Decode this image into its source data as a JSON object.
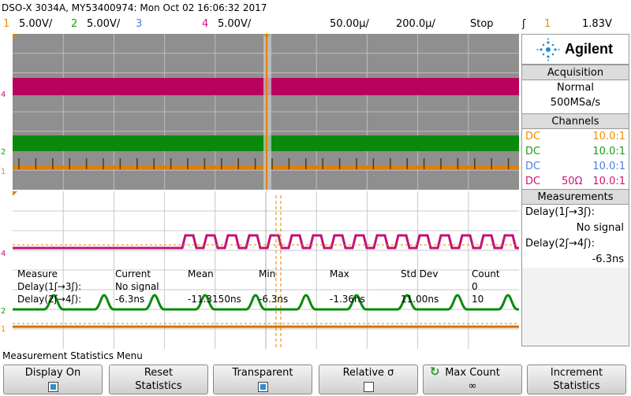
{
  "title": "DSO-X 3034A, MY53400974: Mon Oct 02 16:06:32 2017",
  "channel_bar": {
    "ch1_num": "1",
    "ch1_scale": "5.00V/",
    "ch2_num": "2",
    "ch2_scale": "5.00V/",
    "ch3_num": "3",
    "ch4_num": "4",
    "ch4_scale": "5.00V/",
    "time_delay": "50.00µ/",
    "time_scale": "200.0µ/",
    "run_state": "Stop",
    "trigger_icon": "ʃ",
    "trigger_source": "1",
    "trigger_level": "1.83V"
  },
  "side_panel": {
    "brand": "Agilent",
    "acquisition_title": "Acquisition",
    "acq_mode": "Normal",
    "acq_rate": "500MSa/s",
    "channels_title": "Channels",
    "channels": [
      {
        "coupling": "DC",
        "impedance": "",
        "ratio": "10.0:1",
        "color": "#f28c00"
      },
      {
        "coupling": "DC",
        "impedance": "",
        "ratio": "10.0:1",
        "color": "#17a017"
      },
      {
        "coupling": "DC",
        "impedance": "",
        "ratio": "10.0:1",
        "color": "#4f7ee0"
      },
      {
        "coupling": "DC",
        "impedance": "50Ω",
        "ratio": "10.0:1",
        "color": "#d0127a"
      }
    ],
    "measurements_title": "Measurements",
    "meas1_label": "Delay(1ʃ→3ʃ):",
    "meas1_value": "No signal",
    "meas2_label": "Delay(2ʃ→4ʃ):",
    "meas2_value": "-6.3ns"
  },
  "stats_table": {
    "h_measure": "Measure",
    "h_current": "Current",
    "h_mean": "Mean",
    "h_min": "Min",
    "h_max": "Max",
    "h_std": "Std Dev",
    "h_count": "Count",
    "r1_name": "Delay(1ʃ→3ʃ):",
    "r1_current": "No signal",
    "r1_count": "0",
    "r2_name": "Delay(2ʃ→4ʃ):",
    "r2_current": "-6.3ns",
    "r2_mean": "-11.3150ns",
    "r2_min": "-6.3ns",
    "r2_max": "-1.36ns",
    "r2_std": "11.00ns",
    "r2_count": "10"
  },
  "menu_title": "Measurement Statistics Menu",
  "softkeys": [
    {
      "line1": "Display On",
      "line2": "",
      "checkbox": true,
      "checked": true
    },
    {
      "line1": "Reset",
      "line2": "Statistics",
      "checkbox": false
    },
    {
      "line1": "Transparent",
      "line2": "",
      "checkbox": true,
      "checked": true
    },
    {
      "line1": "Relative σ",
      "line2": "",
      "checkbox": true,
      "checked": false
    },
    {
      "line1": "Max Count",
      "line2": "∞",
      "checkbox": false
    },
    {
      "line1": "Increment",
      "line2": "Statistics",
      "checkbox": false
    }
  ],
  "colors": {
    "ch1": "#f28c00",
    "ch2": "#17a017",
    "ch3": "#4f7ee0",
    "ch4": "#d0127a"
  }
}
